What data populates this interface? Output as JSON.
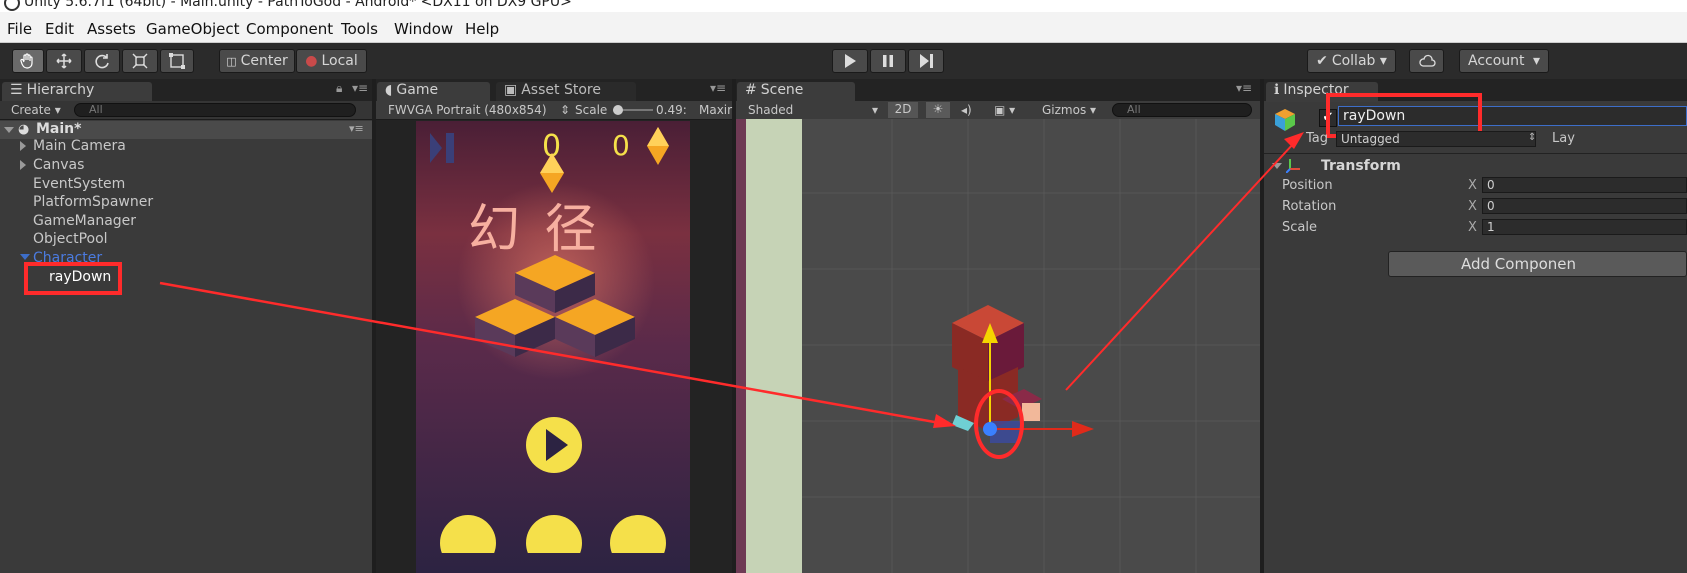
{
  "window": {
    "title": "Unity 5.6.7f1 (64bit) - Main.unity - PathToGod - Android* <DX11 on DX9 GPU>"
  },
  "menu": [
    "File",
    "Edit",
    "Assets",
    "GameObject",
    "Component",
    "Tools",
    "Window",
    "Help"
  ],
  "toolbar": {
    "tools": [
      "hand-icon",
      "move-icon",
      "rotate-icon",
      "scale-icon",
      "rect-icon"
    ],
    "pivot_center": "Center",
    "pivot_local": "Local",
    "collab": "Collab ▾",
    "account": "Account",
    "account_caret": "▾"
  },
  "hierarchy": {
    "tab": "Hierarchy",
    "create": "Create ▾",
    "search_placeholder": "All",
    "scene": "Main*",
    "items": [
      "Main Camera",
      "Canvas",
      "EventSystem",
      "PlatformSpawner",
      "GameManager",
      "ObjectPool",
      "Character",
      "rayDown"
    ]
  },
  "game": {
    "tab_game": "Game",
    "tab_asset_store": "Asset Store",
    "resolution": "FWVGA Portrait (480x854)",
    "scale_label": "Scale",
    "scale_value": "0.49:",
    "maximize": "Maxir",
    "score": "0",
    "gems": "0",
    "title_text": "幻  径"
  },
  "scene": {
    "tab": "Scene",
    "shading": "Shaded",
    "mode_2d": "2D",
    "gizmos": "Gizmos ▾",
    "search_placeholder": "All"
  },
  "inspector": {
    "tab": "Inspector",
    "name": "rayDown",
    "tag_label": "Tag",
    "tag_value": "Untagged",
    "layer_label": "Lay",
    "component": "Transform",
    "rows": [
      {
        "label": "Position",
        "axis": "X",
        "value": "0"
      },
      {
        "label": "Rotation",
        "axis": "X",
        "value": "0"
      },
      {
        "label": "Scale",
        "axis": "X",
        "value": "1"
      }
    ],
    "add_component": "Add Componen"
  },
  "colors": {
    "annotation": "#ff2b2b",
    "selection": "#3d6ec9",
    "ui_yellow": "#f5e04a"
  }
}
